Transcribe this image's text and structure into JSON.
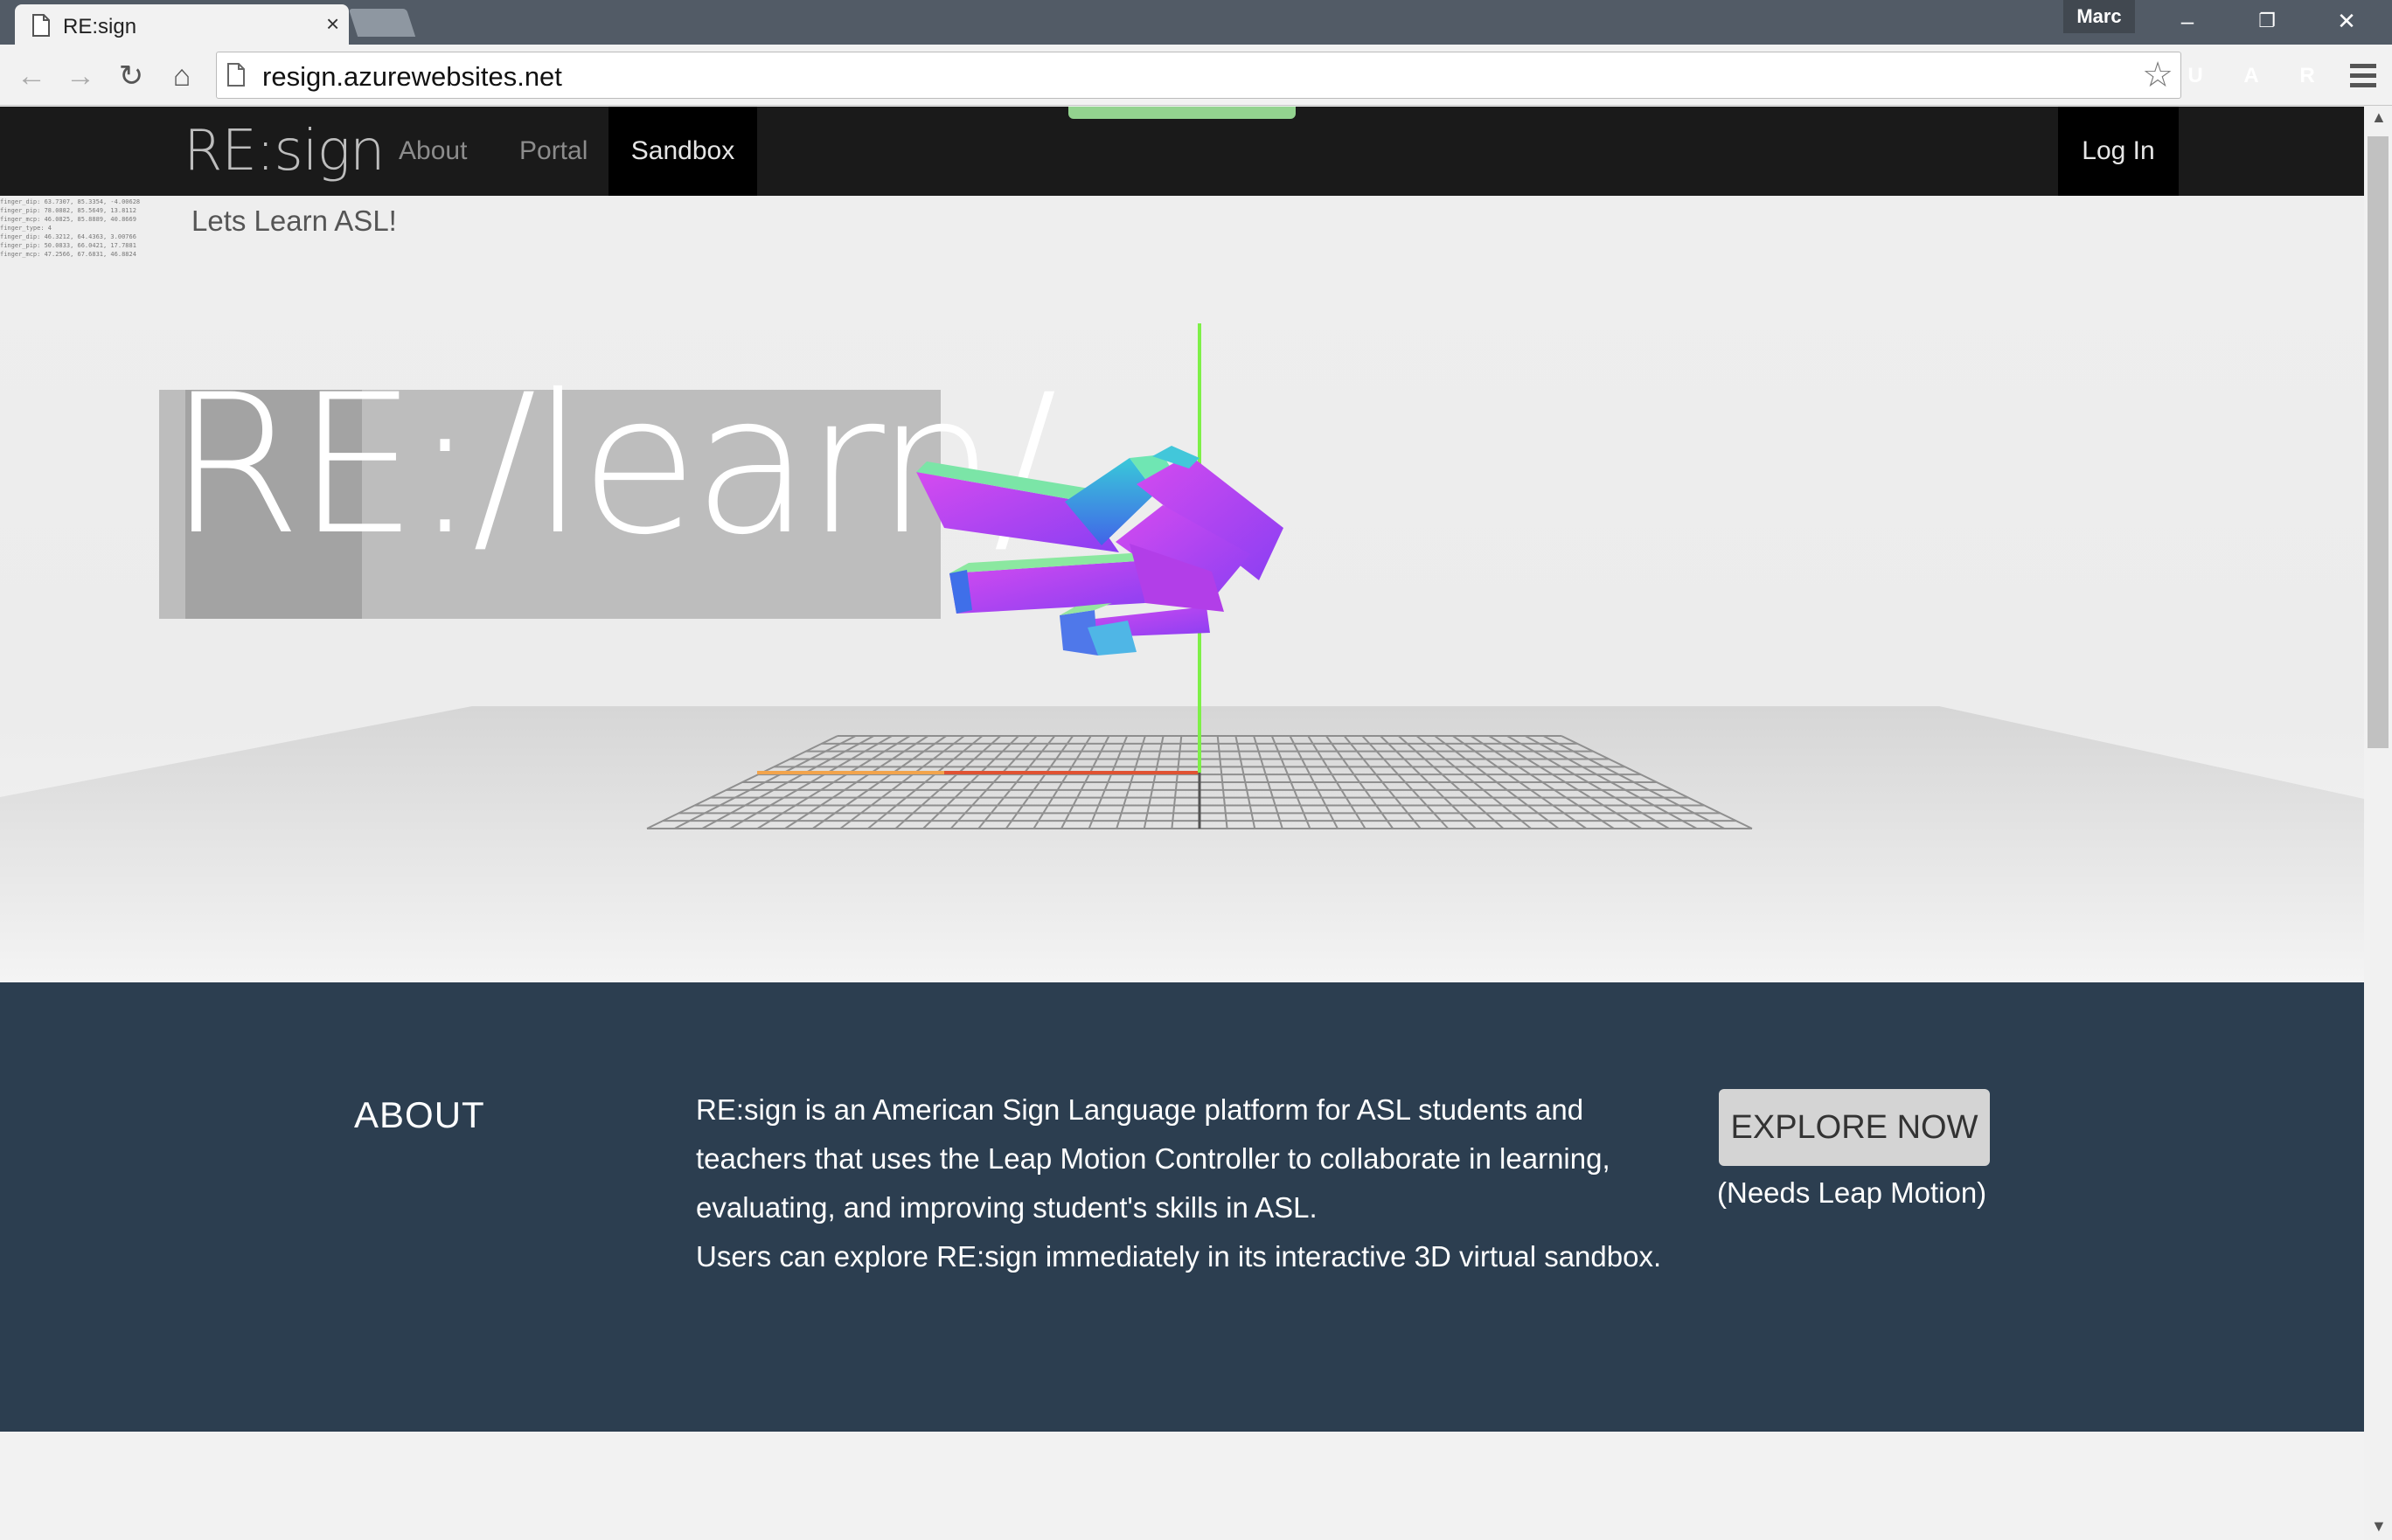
{
  "browser": {
    "tab_title": "RE:sign",
    "tab_close": "×",
    "profile_name": "Marc",
    "url": "resign.azurewebsites.net",
    "window_controls": {
      "minimize": "–",
      "restore": "❐",
      "close": "✕"
    },
    "nav_icons": {
      "back": "←",
      "forward": "→",
      "reload": "↻",
      "home": "⌂",
      "star": "☆"
    },
    "extensions": [
      {
        "icon": "ublock-icon",
        "glyph": "U",
        "color": "#9b0f12"
      },
      {
        "icon": "acrobat-icon",
        "glyph": "A",
        "color": "#e1442b"
      },
      {
        "icon": "lastpass-icon",
        "glyph": "R",
        "color": "#d9282f"
      }
    ]
  },
  "site": {
    "brand": "RE:sign",
    "nav": [
      {
        "label": "About",
        "active": false
      },
      {
        "label": "Portal",
        "active": false
      },
      {
        "label": "Sandbox",
        "active": true
      }
    ],
    "login": "Log In",
    "accent_color": "#93d38f"
  },
  "hero": {
    "tagline": "Lets Learn ASL!",
    "logo_text": "RE:/learn/",
    "debug_lines": [
      "finger_dip: 63.7307, 85.3354, -4.00628",
      "finger_pip: 78.0882, 85.5649, 13.8112",
      "finger_mcp: 46.0825, 85.8889, 40.8669",
      "finger_type: 4",
      "finger_dip: 46.3212, 64.4363, 3.00766",
      "finger_pip: 50.0833, 66.0421, 17.7881",
      "finger_mcp: 47.2566, 67.6831, 46.8824"
    ]
  },
  "about": {
    "title": "ABOUT",
    "paragraph1": "RE:sign is an American Sign Language platform for ASL students and teachers that uses the Leap Motion Controller to collaborate in learning, evaluating, and improving student's skills in ASL.",
    "paragraph2": "Users can explore RE:sign immediately in its interactive 3D virtual sandbox.",
    "cta": "EXPLORE NOW",
    "cta_note": "(Needs Leap Motion)",
    "background_color": "#2c3e50"
  }
}
